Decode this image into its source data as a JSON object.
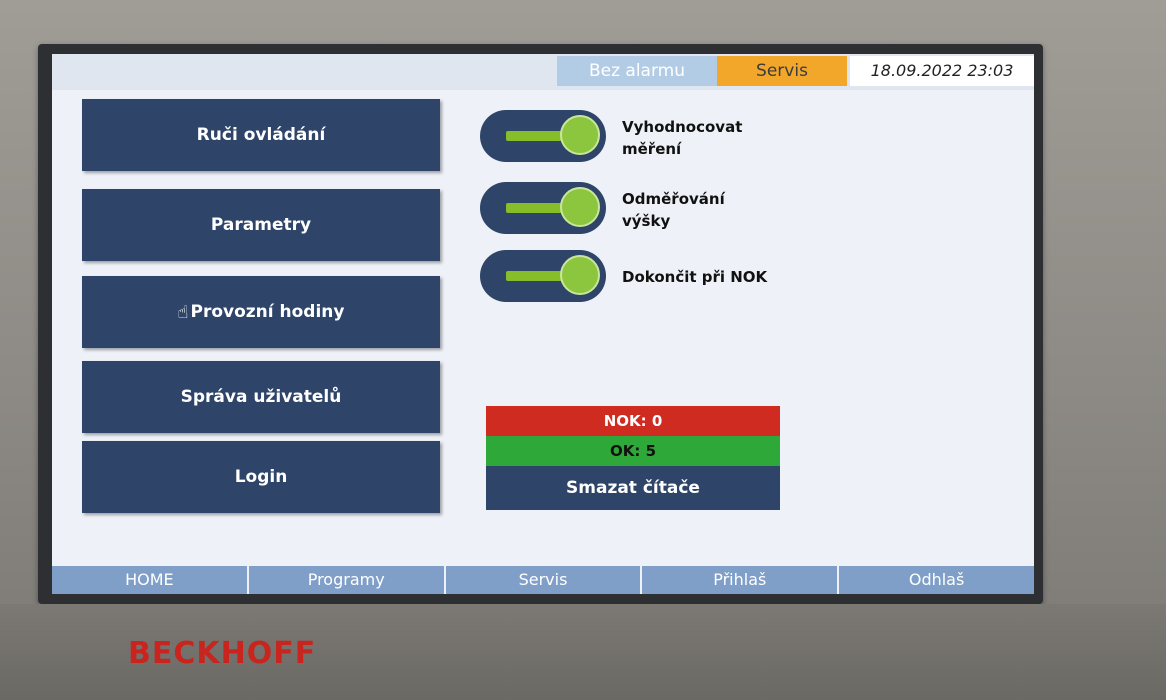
{
  "header": {
    "alarm_status": "Bez alarmu",
    "mode": "Servis",
    "datetime": "18.09.2022 23:03"
  },
  "menu": {
    "items": [
      {
        "label": "Ruči ovládání"
      },
      {
        "label": "Parametry"
      },
      {
        "label": "Provozní hodiny"
      },
      {
        "label": "Správa uživatelů"
      },
      {
        "label": "Login"
      }
    ]
  },
  "toggles": [
    {
      "label": "Vyhodnocovat\nměření",
      "state": "on"
    },
    {
      "label": "Odměřování\nvýšky",
      "state": "on"
    },
    {
      "label": "Dokončit při NOK",
      "state": "on"
    }
  ],
  "counters": {
    "nok": "NOK: 0",
    "ok": "OK: 5",
    "reset_label": "Smazat čítače"
  },
  "bottom_nav": {
    "items": [
      {
        "label": "HOME"
      },
      {
        "label": "Programy"
      },
      {
        "label": "Servis"
      },
      {
        "label": "Přihlaš"
      },
      {
        "label": "Odhlaš"
      }
    ]
  },
  "brand": {
    "logo_text": "BECKHOFF"
  },
  "colors": {
    "button_bg": "#2e4468",
    "toggle_green": "#8cc63f",
    "nok_red": "#d02b20",
    "ok_green": "#2fa83a",
    "mode_orange": "#f2a72a",
    "nav_blue": "#7f9fc8",
    "logo_red": "#c9251e"
  }
}
